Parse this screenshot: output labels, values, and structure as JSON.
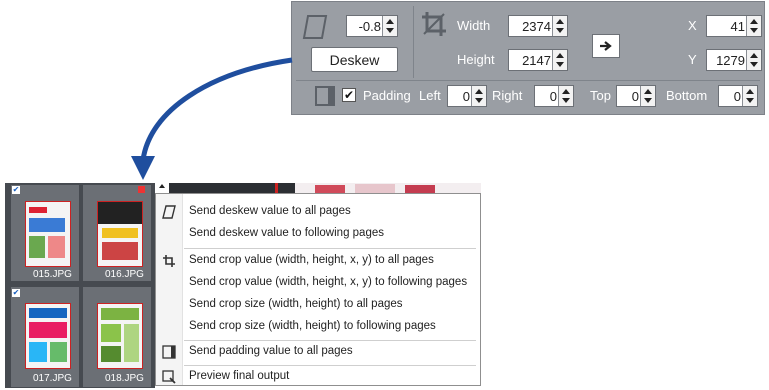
{
  "toolbar": {
    "deskew_value": "-0.8",
    "deskew_button": "Deskew",
    "width_label": "Width",
    "width_value": "2374",
    "height_label": "Height",
    "height_value": "2147",
    "x_label": "X",
    "x_value": "41",
    "y_label": "Y",
    "y_value": "1279",
    "padding_label": "Padding",
    "padding_checked": true,
    "left_label": "Left",
    "left_value": "0",
    "right_label": "Right",
    "right_value": "0",
    "top_label": "Top",
    "top_value": "0",
    "bottom_label": "Bottom",
    "bottom_value": "0"
  },
  "thumbnails": [
    {
      "name": "015.JPG"
    },
    {
      "name": "016.JPG"
    },
    {
      "name": "017.JPG"
    },
    {
      "name": "018.JPG"
    }
  ],
  "menu": {
    "items": [
      "Send deskew value to all pages",
      "Send deskew value to following pages",
      "Send crop value (width, height, x, y) to all pages",
      "Send crop value (width, height, x, y) to following pages",
      "Send crop size (width, height) to all pages",
      "Send crop size (width, height) to following pages",
      "Send padding value to all pages",
      "Preview final output"
    ]
  },
  "colors": {
    "panel": "#9a9ea4",
    "arrow": "#1f4e9e",
    "thumbs_bg": "#464a50",
    "crop_border": "#cc2222"
  }
}
